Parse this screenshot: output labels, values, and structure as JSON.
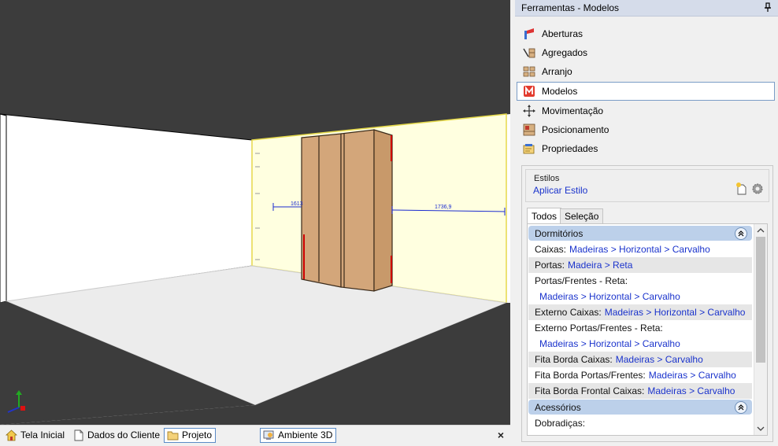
{
  "panel": {
    "title": "Ferramentas - Modelos",
    "tools": [
      {
        "label": "Aberturas",
        "icon": "aberturas-icon"
      },
      {
        "label": "Agregados",
        "icon": "agregados-icon"
      },
      {
        "label": "Arranjo",
        "icon": "arranjo-icon"
      },
      {
        "label": "Modelos",
        "icon": "modelos-icon",
        "selected": true
      },
      {
        "label": "Movimentação",
        "icon": "move-icon"
      },
      {
        "label": "Posicionamento",
        "icon": "position-icon"
      },
      {
        "label": "Propriedades",
        "icon": "properties-icon"
      }
    ]
  },
  "styles": {
    "group_label": "Estilos",
    "apply_label": "Aplicar Estilo",
    "tabs": [
      "Todos",
      "Seleção"
    ],
    "sections": [
      {
        "title": "Dormitórios",
        "props": [
          {
            "label": "Caixas:",
            "value": "Madeiras > Horizontal > Carvalho"
          },
          {
            "label": "Portas:",
            "value": "Madeira > Reta"
          },
          {
            "label": "Portas/Frentes - Reta:",
            "value": "Madeiras > Horizontal > Carvalho"
          },
          {
            "label": "Externo Caixas:",
            "value": "Madeiras > Horizontal > Carvalho"
          },
          {
            "label": "Externo Portas/Frentes - Reta:",
            "value": "Madeiras > Horizontal > Carvalho"
          },
          {
            "label": "Fita Borda Caixas:",
            "value": "Madeiras > Carvalho"
          },
          {
            "label": "Fita Borda Portas/Frentes:",
            "value": "Madeiras > Carvalho"
          },
          {
            "label": "Fita Borda Frontal Caixas:",
            "value": "Madeiras > Carvalho"
          }
        ]
      },
      {
        "title": "Acessórios",
        "props": [
          {
            "label": "Dobradiças:",
            "value": ""
          }
        ]
      }
    ]
  },
  "viewport": {
    "dimension_left": "1613",
    "dimension_right": "1736,9"
  },
  "bottom_tabs": [
    {
      "label": "Tela Inicial",
      "icon": "home-icon"
    },
    {
      "label": "Dados do Cliente",
      "icon": "document-icon"
    },
    {
      "label": "Projeto",
      "icon": "folder-icon",
      "active": true
    },
    {
      "label": "Ambiente 3D",
      "icon": "ambiente-3d-icon",
      "active": true
    }
  ],
  "close_label": "×",
  "colors": {
    "accent": "#1a33cc",
    "header": "#d5dcea",
    "section": "#bcd0ea",
    "wood": "#d3a67a",
    "wall": "#ffffe0"
  }
}
